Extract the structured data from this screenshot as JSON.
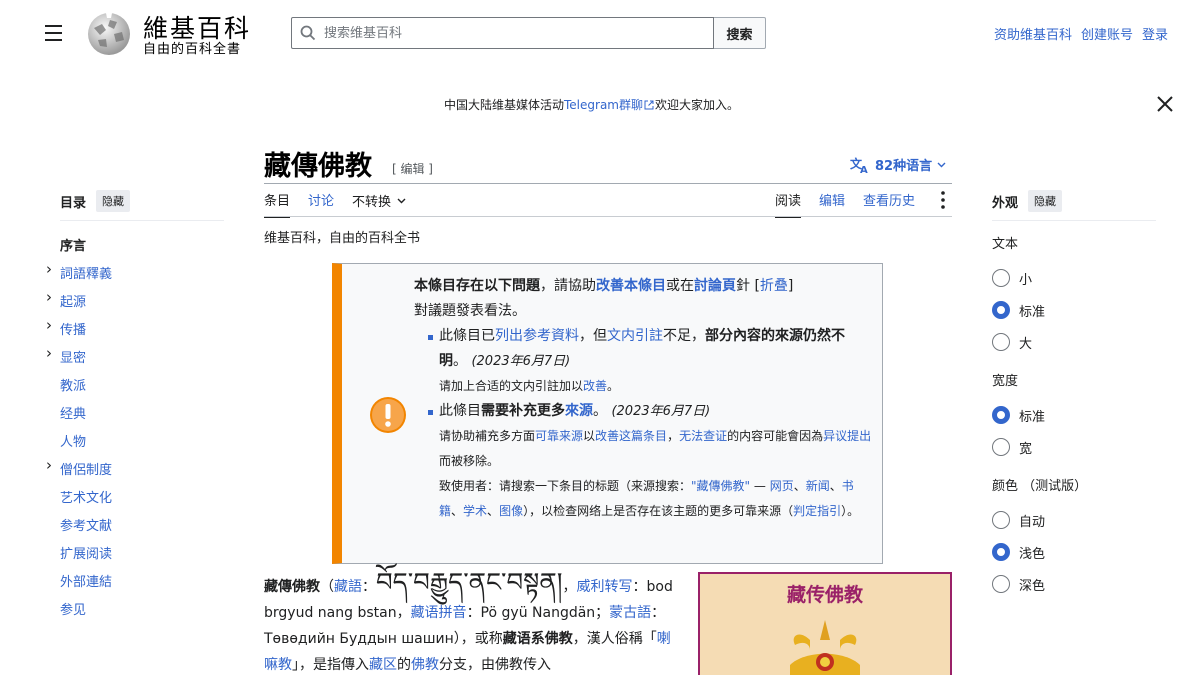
{
  "header": {
    "logo_word": "維基百科",
    "logo_tagline": "自由的百科全書",
    "search_placeholder": "搜索维基百科",
    "search_button": "搜索",
    "user_links": [
      "资助维基百科",
      "创建账号",
      "登录"
    ]
  },
  "notice": {
    "before": "中国大陆维基媒体活动",
    "link": "Telegram群聊",
    "after": "欢迎大家加入。"
  },
  "article": {
    "title": "藏傳佛教",
    "edit_label": "[ 编辑 ]",
    "languages": "82种语言",
    "subtitle": "维基百科，自由的百科全书"
  },
  "tabs": {
    "left": [
      "条目",
      "讨论"
    ],
    "variant": "不转换",
    "right": [
      "阅读",
      "编辑",
      "查看历史"
    ]
  },
  "toc": {
    "heading": "目录",
    "hide": "隐藏",
    "items": [
      {
        "label": "序言",
        "current": true,
        "expand": false
      },
      {
        "label": "詞語釋義",
        "expand": true
      },
      {
        "label": "起源",
        "expand": true
      },
      {
        "label": "传播",
        "expand": true
      },
      {
        "label": "显密",
        "expand": true
      },
      {
        "label": "教派",
        "expand": false
      },
      {
        "label": "经典",
        "expand": false
      },
      {
        "label": "人物",
        "expand": false
      },
      {
        "label": "僧侶制度",
        "expand": true
      },
      {
        "label": "艺术文化",
        "expand": false
      },
      {
        "label": "参考文献",
        "expand": false
      },
      {
        "label": "扩展阅读",
        "expand": false
      },
      {
        "label": "外部連結",
        "expand": false
      },
      {
        "label": "参见",
        "expand": false
      }
    ]
  },
  "appearance": {
    "heading": "外观",
    "hide": "隐藏",
    "groups": [
      {
        "label": "文本",
        "options": [
          {
            "label": "小",
            "checked": false
          },
          {
            "label": "标准",
            "checked": true
          },
          {
            "label": "大",
            "checked": false
          }
        ]
      },
      {
        "label": "宽度",
        "options": [
          {
            "label": "标准",
            "checked": true
          },
          {
            "label": "宽",
            "checked": false
          }
        ]
      },
      {
        "label": "颜色 （测试版）",
        "options": [
          {
            "label": "自动",
            "checked": false
          },
          {
            "label": "浅色",
            "checked": true
          },
          {
            "label": "深色",
            "checked": false
          }
        ]
      }
    ]
  },
  "ambox": {
    "intro_bold": "本條目存在以下問題",
    "intro_1": "，請協助",
    "intro_link1": "改善本條目",
    "intro_2": "或在",
    "intro_link2": "討論頁",
    "intro_3": "針",
    "collapse": "折叠",
    "intro_4": "對議題發表看法。",
    "i1_a": "此條目已",
    "i1_link1": "列出参考資料",
    "i1_b": "，但",
    "i1_link2": "文内引註",
    "i1_c": "不足，",
    "i1_bold": "部分內容的來源仍然不明",
    "i1_d": "。",
    "i1_date": "(2023年6月7日)",
    "i1_note_a": "请加上合适的文内引註加以",
    "i1_note_link": "改善",
    "i1_note_b": "。",
    "i2_a": "此條目",
    "i2_bold": "需要补充更多",
    "i2_link": "來源",
    "i2_b": "。",
    "i2_date": "(2023年6月7日)",
    "i2_n1": "请协助補充多方面",
    "i2_l1": "可靠来源",
    "i2_n2": "以",
    "i2_l2": "改善这篇条目",
    "i2_n3": "，",
    "i2_l3": "无法查证",
    "i2_n4": "的内容可能會因為",
    "i2_l4": "异议提出",
    "i2_n5": "而被移除。",
    "i2_n6": "致使用者：请搜索一下条目的标题（来源搜索：",
    "i2_l5": "\"藏傳佛教\"",
    "i2_n7": " — ",
    "i2_l6": "网页",
    "i2_n8": "、",
    "i2_l7": "新闻",
    "i2_l8": "书籍",
    "i2_l9": "学术",
    "i2_l10": "图像",
    "i2_n9": "），以检查网络上是否存在该主题的更多可靠来源（",
    "i2_l11": "判定指引",
    "i2_n10": "）。"
  },
  "lead": {
    "b1": "藏傳佛教",
    "t1": "（",
    "l1": "藏語",
    "t2": "：",
    "tibetan": "བོད་བརྒྱུད་ནང་བསྟན།",
    "t3": "，",
    "l2": "威利转写",
    "t4": "：bod brgyud nang bstan，",
    "l3": "藏语拼音",
    "t5": "：Pö gyü Nangdän；",
    "l4": "蒙古語",
    "t6": "：Төвөдийн Буддын шашин），或称",
    "b2": "藏语系佛教",
    "t7": "，漢人俗稱「",
    "l5": "喇嘛教",
    "t8": "」，是指傳入",
    "l6": "藏区",
    "t9": "的",
    "l7": "佛教",
    "t10": "分支，由佛教传入"
  },
  "infobox": {
    "title": "藏传佛教"
  },
  "colors": {
    "link": "#3366cc",
    "ambox_accent": "#f28500",
    "infobox_border": "#9a2168",
    "infobox_bg": "#f5dcb4"
  }
}
